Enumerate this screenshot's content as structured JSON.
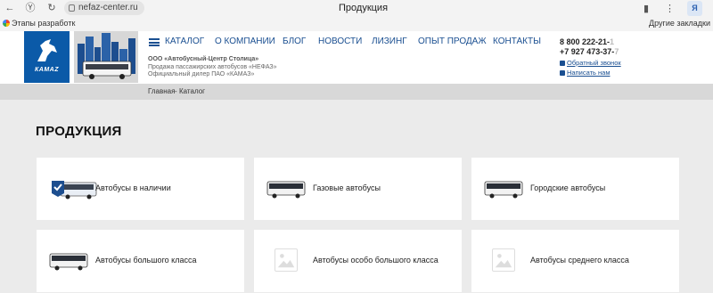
{
  "browser": {
    "url": "nefaz-center.ru",
    "tab_title": "Продукция",
    "bookmark_item": "Этапы разработк",
    "bookmarks_other": "Другие закладки"
  },
  "header": {
    "kamaz_brand": "КАМАZ",
    "menu": [
      "КАТАЛОГ",
      "О КОМПАНИИ",
      "БЛОГ",
      "НОВОСТИ",
      "ЛИЗИНГ",
      "ОПЫТ ПРОДАЖ",
      "КОНТАКТЫ"
    ],
    "company_lines": [
      "ООО «Автобусный-Центр Столица»",
      "Продажа пассажирских автобусов «НЕФАЗ»",
      "Официальный дилер ПАО «КАМАЗ»"
    ],
    "phone1": "8 800 222-21-",
    "phone1_fade": "1",
    "phone2": "+7 927 473-37-",
    "phone2_fade": "7",
    "callback": "Обратный звонок",
    "write_us": "Написать нам"
  },
  "breadcrumb": {
    "home": "Главная",
    "separator": "-",
    "current": "Каталог"
  },
  "page": {
    "title": "ПРОДУКЦИЯ"
  },
  "categories": [
    {
      "label": "Автобусы в наличии",
      "icon": "bus-check-icon"
    },
    {
      "label": "Газовые автобусы",
      "icon": "bus-icon"
    },
    {
      "label": "Городские автобусы",
      "icon": "bus-icon"
    },
    {
      "label": "Автобусы большого класса",
      "icon": "bus-icon"
    },
    {
      "label": "Автобусы особо большого класса",
      "icon": "image-placeholder-icon"
    },
    {
      "label": "Автобусы среднего класса",
      "icon": "image-placeholder-icon"
    }
  ],
  "colors": {
    "brand_blue": "#1a4f91",
    "kamaz_blue": "#0b5aa8",
    "page_bg": "#ebebeb"
  }
}
